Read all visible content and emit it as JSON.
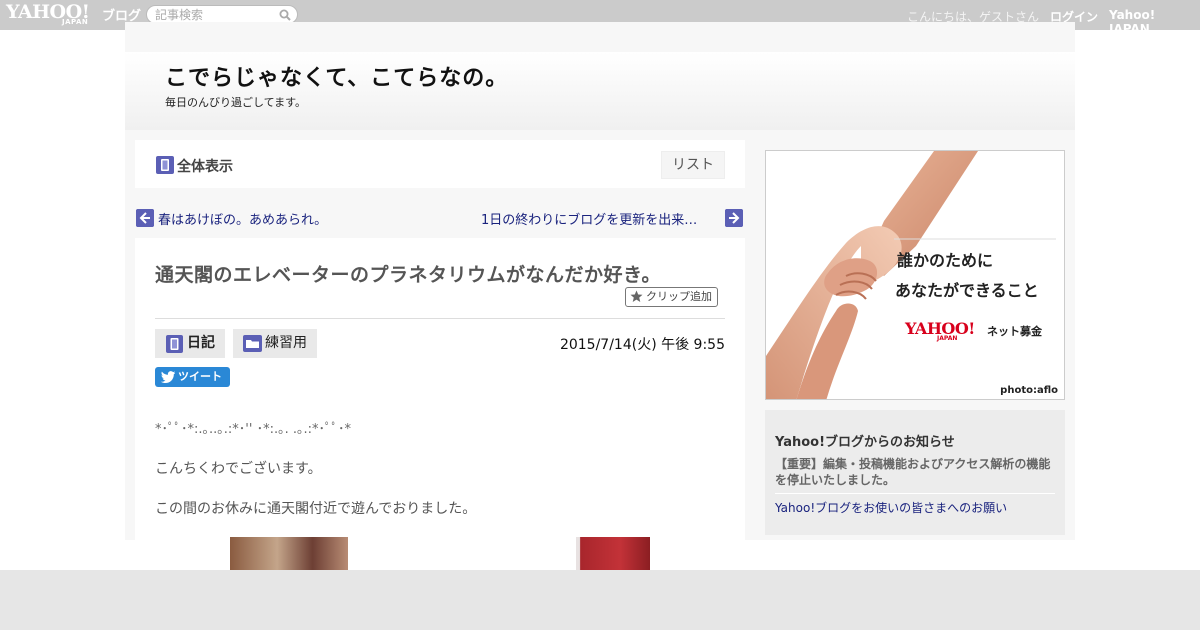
{
  "topbar": {
    "logo_text": "YAHOO!",
    "logo_sub": "JAPAN",
    "logo_blog": "ブログ",
    "search_placeholder": "記事検索",
    "greeting": "こんにちは、ゲストさん",
    "login": "ログイン",
    "yahoo_japan": "Yahoo! JAPAN"
  },
  "blog": {
    "title": "こでらじゃなくて、こてらなの。",
    "description": "毎日のんびり過ごしてます。"
  },
  "viewbar": {
    "view_all": "全体表示",
    "list": "リスト"
  },
  "nav": {
    "prev": "春はあけぼの。あめあられ。",
    "next": "1日の終わりにブログを更新を出来…"
  },
  "post": {
    "title": "通天閣のエレベーターのプラネタリウムがなんだか好き。",
    "clip": "クリップ追加",
    "category": "日記",
    "folder": "練習用",
    "date": "2015/7/14(火) 午後 9:55",
    "tweet": "ツイート",
    "decoration": "*･ﾟﾟ･*:.｡..｡.:*･'' ･*:.｡. .｡.:*･ﾟﾟ･*",
    "line1": "こんちくわでございます。",
    "line2": "この間のお休みに通天閣付近で遊んでおりました。"
  },
  "ad": {
    "line1": "誰かのために",
    "line2": "あなたができること",
    "logo": "YAHOO!",
    "logo_sub": "JAPAN",
    "service": "ネット募金",
    "credit": "photo:aflo"
  },
  "notice": {
    "title": "Yahoo!ブログからのお知らせ",
    "important": "【重要】編集・投稿機能およびアクセス解析の機能を停止いたしました。",
    "link": "Yahoo!ブログをお使いの皆さまへのお願い"
  },
  "colors": {
    "topbar_bg": "#cbcbcb",
    "link": "#1a237e",
    "icon_accent": "#5b5fb5",
    "tweet": "#2a88d6",
    "ad_red": "#d8001c"
  }
}
